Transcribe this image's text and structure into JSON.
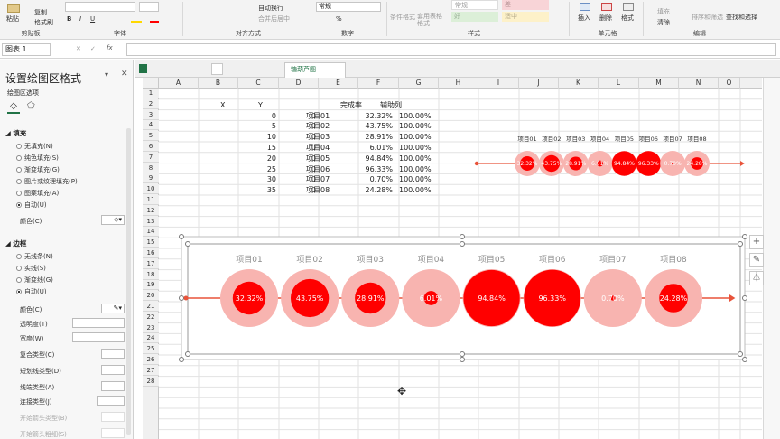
{
  "ribbon": {
    "paste": "粘贴",
    "copy": "复制",
    "format_painter": "格式刷",
    "clipboard": "剪贴板",
    "font": "字体",
    "alignment": "对齐方式",
    "number": "数字",
    "styles": "样式",
    "cells": "单元格",
    "editing": "编辑",
    "wrap_text": "自动换行",
    "merge_center": "合并后居中",
    "number_format": "常规",
    "conditional_format": "条件格式",
    "table_format": "套用表格格式",
    "style_normal": "常规",
    "style_bad": "差",
    "style_good": "好",
    "style_neutral": "适中",
    "insert": "插入",
    "delete": "删除",
    "format": "格式",
    "fill": "填充",
    "clear": "清除",
    "sort_filter": "排序和筛选",
    "find_select": "查找和选择"
  },
  "formula_bar": {
    "name_box": "图表 1"
  },
  "pane": {
    "title": "设置绘图区格式",
    "subtitle": "绘图区选项",
    "fill_section": "填充",
    "fill_options": [
      "无填充(N)",
      "纯色填充(S)",
      "渐变填充(G)",
      "图片或纹理填充(P)",
      "图案填充(A)",
      "自动(U)"
    ],
    "fill_color": "颜色(C)",
    "border_section": "边框",
    "border_options": [
      "无线条(N)",
      "实线(S)",
      "渐变线(G)",
      "自动(U)"
    ],
    "border_props": [
      "颜色(C)",
      "透明度(T)",
      "宽度(W)",
      "复合类型(C)",
      "短划线类型(D)",
      "线端类型(A)",
      "连接类型(J)",
      "开始箭头类型(B)",
      "开始箭头粗细(S)"
    ]
  },
  "workbook": {
    "file_name": "糖葫芦图表.xlsx"
  },
  "columns": [
    "A",
    "B",
    "C",
    "D",
    "E",
    "F",
    "G",
    "H",
    "I",
    "J",
    "K",
    "L",
    "M",
    "N",
    "O"
  ],
  "rows": [
    "1",
    "2",
    "3",
    "4",
    "5",
    "6",
    "7",
    "8",
    "9",
    "10",
    "11",
    "12",
    "13",
    "14",
    "15",
    "16",
    "17",
    "18",
    "19",
    "20",
    "21",
    "22",
    "23",
    "24",
    "25",
    "26",
    "27",
    "28"
  ],
  "table": {
    "headers": [
      "X",
      "Y",
      "",
      "完成率",
      "辅助列"
    ],
    "rows": [
      {
        "x": "0",
        "y": "0",
        "name": "项目01",
        "rate": "32.32%",
        "aux": "100.00%"
      },
      {
        "x": "5",
        "y": "0",
        "name": "项目02",
        "rate": "43.75%",
        "aux": "100.00%"
      },
      {
        "x": "10",
        "y": "0",
        "name": "项目03",
        "rate": "28.91%",
        "aux": "100.00%"
      },
      {
        "x": "15",
        "y": "0",
        "name": "项目04",
        "rate": "6.01%",
        "aux": "100.00%"
      },
      {
        "x": "20",
        "y": "0",
        "name": "项目05",
        "rate": "94.84%",
        "aux": "100.00%"
      },
      {
        "x": "25",
        "y": "0",
        "name": "项目06",
        "rate": "96.33%",
        "aux": "100.00%"
      },
      {
        "x": "30",
        "y": "0",
        "name": "项目07",
        "rate": "0.70%",
        "aux": "100.00%"
      },
      {
        "x": "35",
        "y": "0",
        "name": "项目08",
        "rate": "24.28%",
        "aux": "100.00%"
      }
    ]
  },
  "colors": {
    "accent": "#217346",
    "outer": "#f8b4b0",
    "inner": "#ff0000",
    "line": "#e8533a"
  },
  "chart_data": [
    {
      "type": "scatter",
      "labels": [
        "项目01",
        "项目02",
        "项目03",
        "项目04",
        "项目05",
        "项目06",
        "项目07",
        "项目08"
      ],
      "x": [
        0,
        5,
        10,
        15,
        20,
        25,
        30,
        35
      ],
      "y": [
        0,
        0,
        0,
        0,
        0,
        0,
        0,
        0
      ],
      "values": [
        32.32,
        43.75,
        28.91,
        6.01,
        94.84,
        96.33,
        0.7,
        24.28
      ],
      "value_labels": [
        "32.32%",
        "43.75%",
        "28.91%",
        "6.01%",
        "94.84%",
        "96.33%",
        "0.70%",
        "24.28%"
      ],
      "aux": [
        100,
        100,
        100,
        100,
        100,
        100,
        100,
        100
      ]
    },
    {
      "type": "scatter",
      "labels": [
        "项目01",
        "项目02",
        "项目03",
        "项目04",
        "项目05",
        "项目06",
        "项目07",
        "项目08"
      ],
      "x": [
        0,
        5,
        10,
        15,
        20,
        25,
        30,
        35
      ],
      "y": [
        0,
        0,
        0,
        0,
        0,
        0,
        0,
        0
      ],
      "values": [
        32.32,
        43.75,
        28.91,
        6.01,
        94.84,
        96.33,
        0.7,
        24.28
      ],
      "value_labels": [
        "32.32%",
        "43.75%",
        "28.91%",
        "6.01%",
        "94.84%",
        "96.33%",
        "0.70%",
        "24.28%"
      ],
      "aux": [
        100,
        100,
        100,
        100,
        100,
        100,
        100,
        100
      ]
    }
  ]
}
